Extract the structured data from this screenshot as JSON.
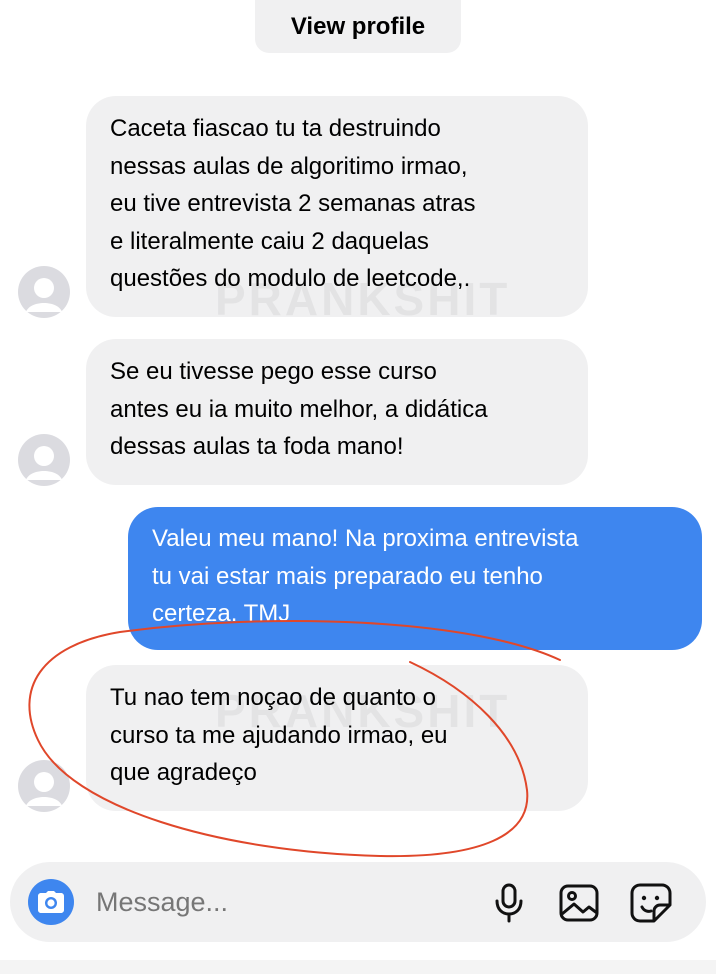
{
  "header": {
    "view_profile_label": "View profile"
  },
  "messages": [
    {
      "sender": "other",
      "text": "Caceta fiascao tu ta destruindo\nnessas aulas de algoritimo irmao,\neu tive entrevista 2 semanas atras\ne literalmente caiu 2 daquelas\nquestões do modulo de leetcode,."
    },
    {
      "sender": "other",
      "text": "Se eu tivesse pego esse curso\nantes eu ia muito melhor, a didática\ndessas aulas ta foda mano!"
    },
    {
      "sender": "me",
      "text": "Valeu meu mano! Na proxima entrevista\ntu vai estar mais preparado eu tenho\ncerteza. TMJ"
    },
    {
      "sender": "other",
      "text": "Tu nao tem noçao de quanto o\ncurso ta me ajudando irmao, eu\nque agradeço"
    }
  ],
  "watermark": "PRANKSHIT",
  "composer": {
    "placeholder": "Message..."
  },
  "icons": {
    "camera": "camera-icon",
    "microphone": "microphone-icon",
    "gallery": "image-icon",
    "sticker": "sticker-icon",
    "avatar": "avatar-icon"
  },
  "colors": {
    "incoming_bubble": "#f0f0f1",
    "outgoing_bubble": "#3e86ef",
    "accent": "#3e86ef",
    "annotation": "#e0472a"
  }
}
